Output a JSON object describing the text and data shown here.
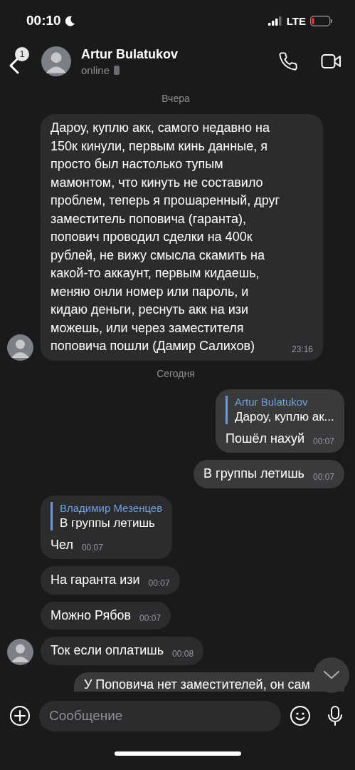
{
  "status_bar": {
    "time": "00:10",
    "network": "LTE"
  },
  "header": {
    "back_badge": "1",
    "name": "Artur Bulatukov",
    "status": "online"
  },
  "messages": [
    {
      "kind": "date",
      "text": "Вчера"
    },
    {
      "kind": "incoming",
      "avatar": true,
      "text": "Дароу, куплю акк, самого недавно на 150к кинули, первым кинь данные, я просто был настолько тупым мамонтом, что кинуть не составило проблем, теперь я прошаренный, друг заместитель поповича (гаранта), попович проводил сделки на 400к рублей, не вижу смысла скамить на какой-то аккаунт, первым кидаешь, меняю онли номер или пароль, и кидаю деньги, реснуть акк на изи можешь, или через заместителя поповича пошли (Дамир Салихов)",
      "time": "23:16"
    },
    {
      "kind": "date",
      "text": "Сегодня"
    },
    {
      "kind": "outgoing",
      "reply": {
        "author": "Artur Bulatukov",
        "text": "Дароу, куплю ак..."
      },
      "text": "Пошёл нахуй",
      "time": "00:07"
    },
    {
      "kind": "outgoing",
      "text": "В группы летишь",
      "time": "00:07"
    },
    {
      "kind": "incoming",
      "avatar": false,
      "reply": {
        "author": "Владимир Мезенцев",
        "text": "В группы летишь"
      },
      "text": "Чел",
      "time": "00:07"
    },
    {
      "kind": "incoming",
      "avatar": false,
      "text": "На гаранта изи",
      "time": "00:07"
    },
    {
      "kind": "incoming",
      "avatar": false,
      "text": "Можно Рябов",
      "time": "00:07"
    },
    {
      "kind": "incoming",
      "avatar": true,
      "text": "Ток если оплатишь",
      "time": "00:08"
    },
    {
      "kind": "outgoing",
      "cut_off": true,
      "text": "У Поповича нет заместителей, он сам"
    }
  ],
  "composer": {
    "placeholder": "Сообщение"
  }
}
